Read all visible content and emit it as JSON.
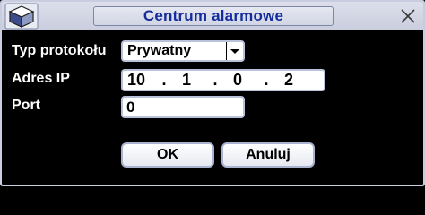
{
  "window": {
    "title": "Centrum alarmowe",
    "close_icon": "close-x-icon",
    "app_icon": "cube-logo-icon"
  },
  "form": {
    "protocol_label": "Typ protokołu",
    "protocol_value": "Prywatny",
    "ip_label": "Adres IP",
    "ip_octets": [
      "10",
      "1",
      "0",
      "2"
    ],
    "ip_separator": ".",
    "port_label": "Port",
    "port_value": "0"
  },
  "buttons": {
    "ok_label": "OK",
    "cancel_label": "Anuluj"
  },
  "colors": {
    "background": "#000000",
    "title_text": "#142c9c",
    "titlebar": "#d2d6e4",
    "field_border": "#b9c1db",
    "label_text": "#ffffff"
  }
}
